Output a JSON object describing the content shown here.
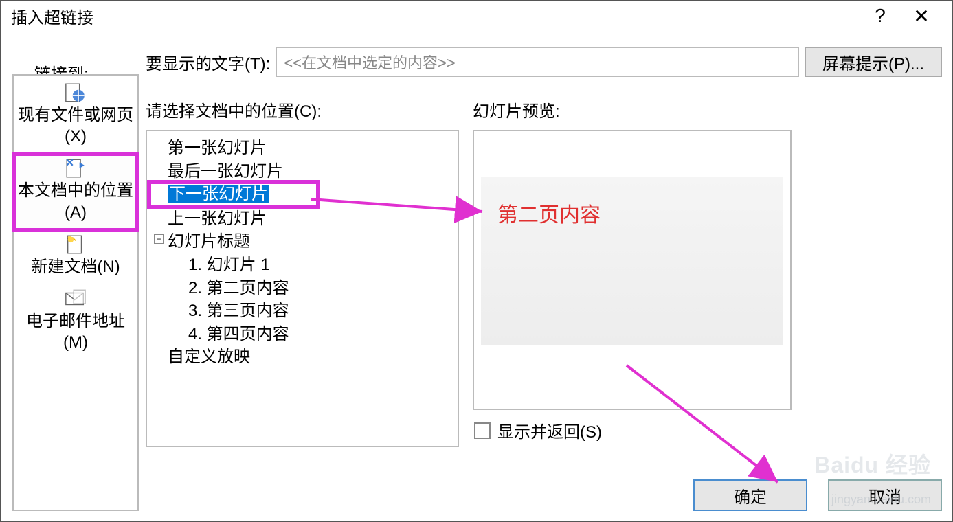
{
  "titlebar": {
    "title": "插入超链接",
    "help": "?",
    "close": "✕"
  },
  "linkto_label": "链接到:",
  "sidebar": {
    "items": [
      {
        "label": "现有文件或网页(X)"
      },
      {
        "label": "本文档中的位置(A)"
      },
      {
        "label": "新建文档(N)"
      },
      {
        "label": "电子邮件地址(M)"
      }
    ]
  },
  "display_text": {
    "label": "要显示的文字(T):",
    "value": "<<在文档中选定的内容>>"
  },
  "screentip": "屏幕提示(P)...",
  "tree_label": "请选择文档中的位置(C):",
  "preview_label": "幻灯片预览:",
  "tree": {
    "first": "第一张幻灯片",
    "last": "最后一张幻灯片",
    "next": "下一张幻灯片",
    "prev": "上一张幻灯片",
    "titles_header": "幻灯片标题",
    "slides": [
      "1. 幻灯片 1",
      "2. 第二页内容",
      "3. 第三页内容",
      "4. 第四页内容"
    ],
    "custom": "自定义放映"
  },
  "checkbox_label": "显示并返回(S)",
  "buttons": {
    "ok": "确定",
    "cancel": "取消"
  },
  "annotation": "第二页内容",
  "watermark": "Baidu 经验",
  "watermark2": "jingyan.baidu.com"
}
